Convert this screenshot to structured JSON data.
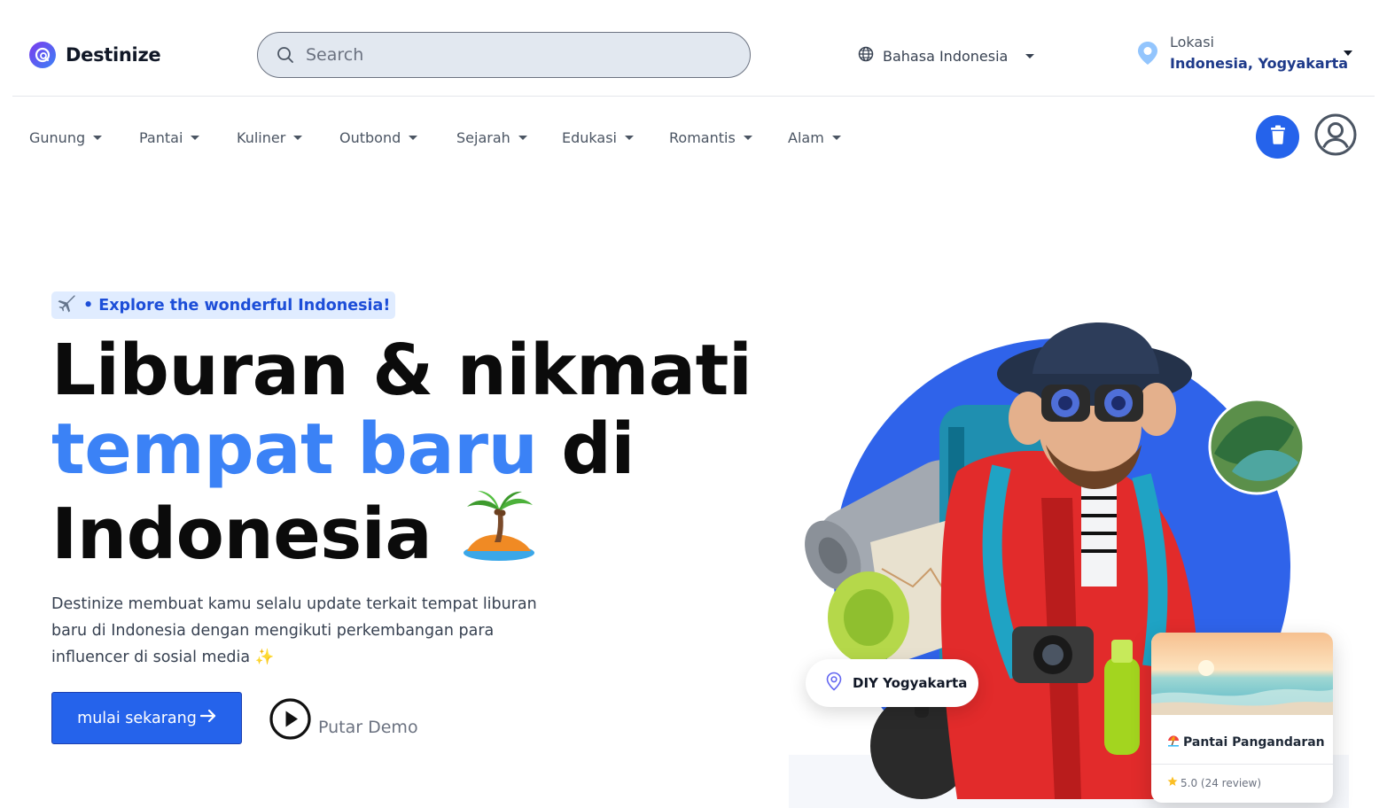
{
  "brand": {
    "name": "Destinize"
  },
  "search": {
    "placeholder": "Search"
  },
  "language": {
    "label": "Bahasa Indonesia"
  },
  "location": {
    "label": "Lokasi",
    "value": "Indonesia, Yogyakarta"
  },
  "categories": [
    {
      "label": "Gunung"
    },
    {
      "label": "Pantai"
    },
    {
      "label": "Kuliner"
    },
    {
      "label": "Outbond"
    },
    {
      "label": "Sejarah"
    },
    {
      "label": "Edukasi"
    },
    {
      "label": "Romantis"
    },
    {
      "label": "Alam"
    }
  ],
  "hero": {
    "tagline": "• Explore the wonderful Indonesia!",
    "headline_part1": "Liburan & nikmati",
    "headline_highlight": "tempat baru",
    "headline_part2": "di",
    "headline_part3": "Indonesia",
    "description": "Destinize membuat kamu selalu update terkait tempat liburan baru di Indonesia dengan mengikuti perkembangan para influencer di sosial media ✨",
    "cta_label": "mulai sekarang",
    "demo_label": "Putar Demo"
  },
  "visual": {
    "location_pill": "DIY Yogyakarta",
    "card_title": "Pantai Pangandaran",
    "card_rating": "5.0 (24 review)"
  },
  "colors": {
    "primary": "#2563eb",
    "highlight": "#3b82f6",
    "location_value": "#1e3a8a"
  },
  "icons": {
    "search": "search-icon",
    "globe": "globe-icon",
    "pin": "map-pin-icon",
    "trash": "trash-icon",
    "user": "user-circle-icon",
    "play": "play-icon",
    "arrow": "arrow-right-icon",
    "plane": "airplane-icon",
    "palm": "palm-island-icon"
  }
}
